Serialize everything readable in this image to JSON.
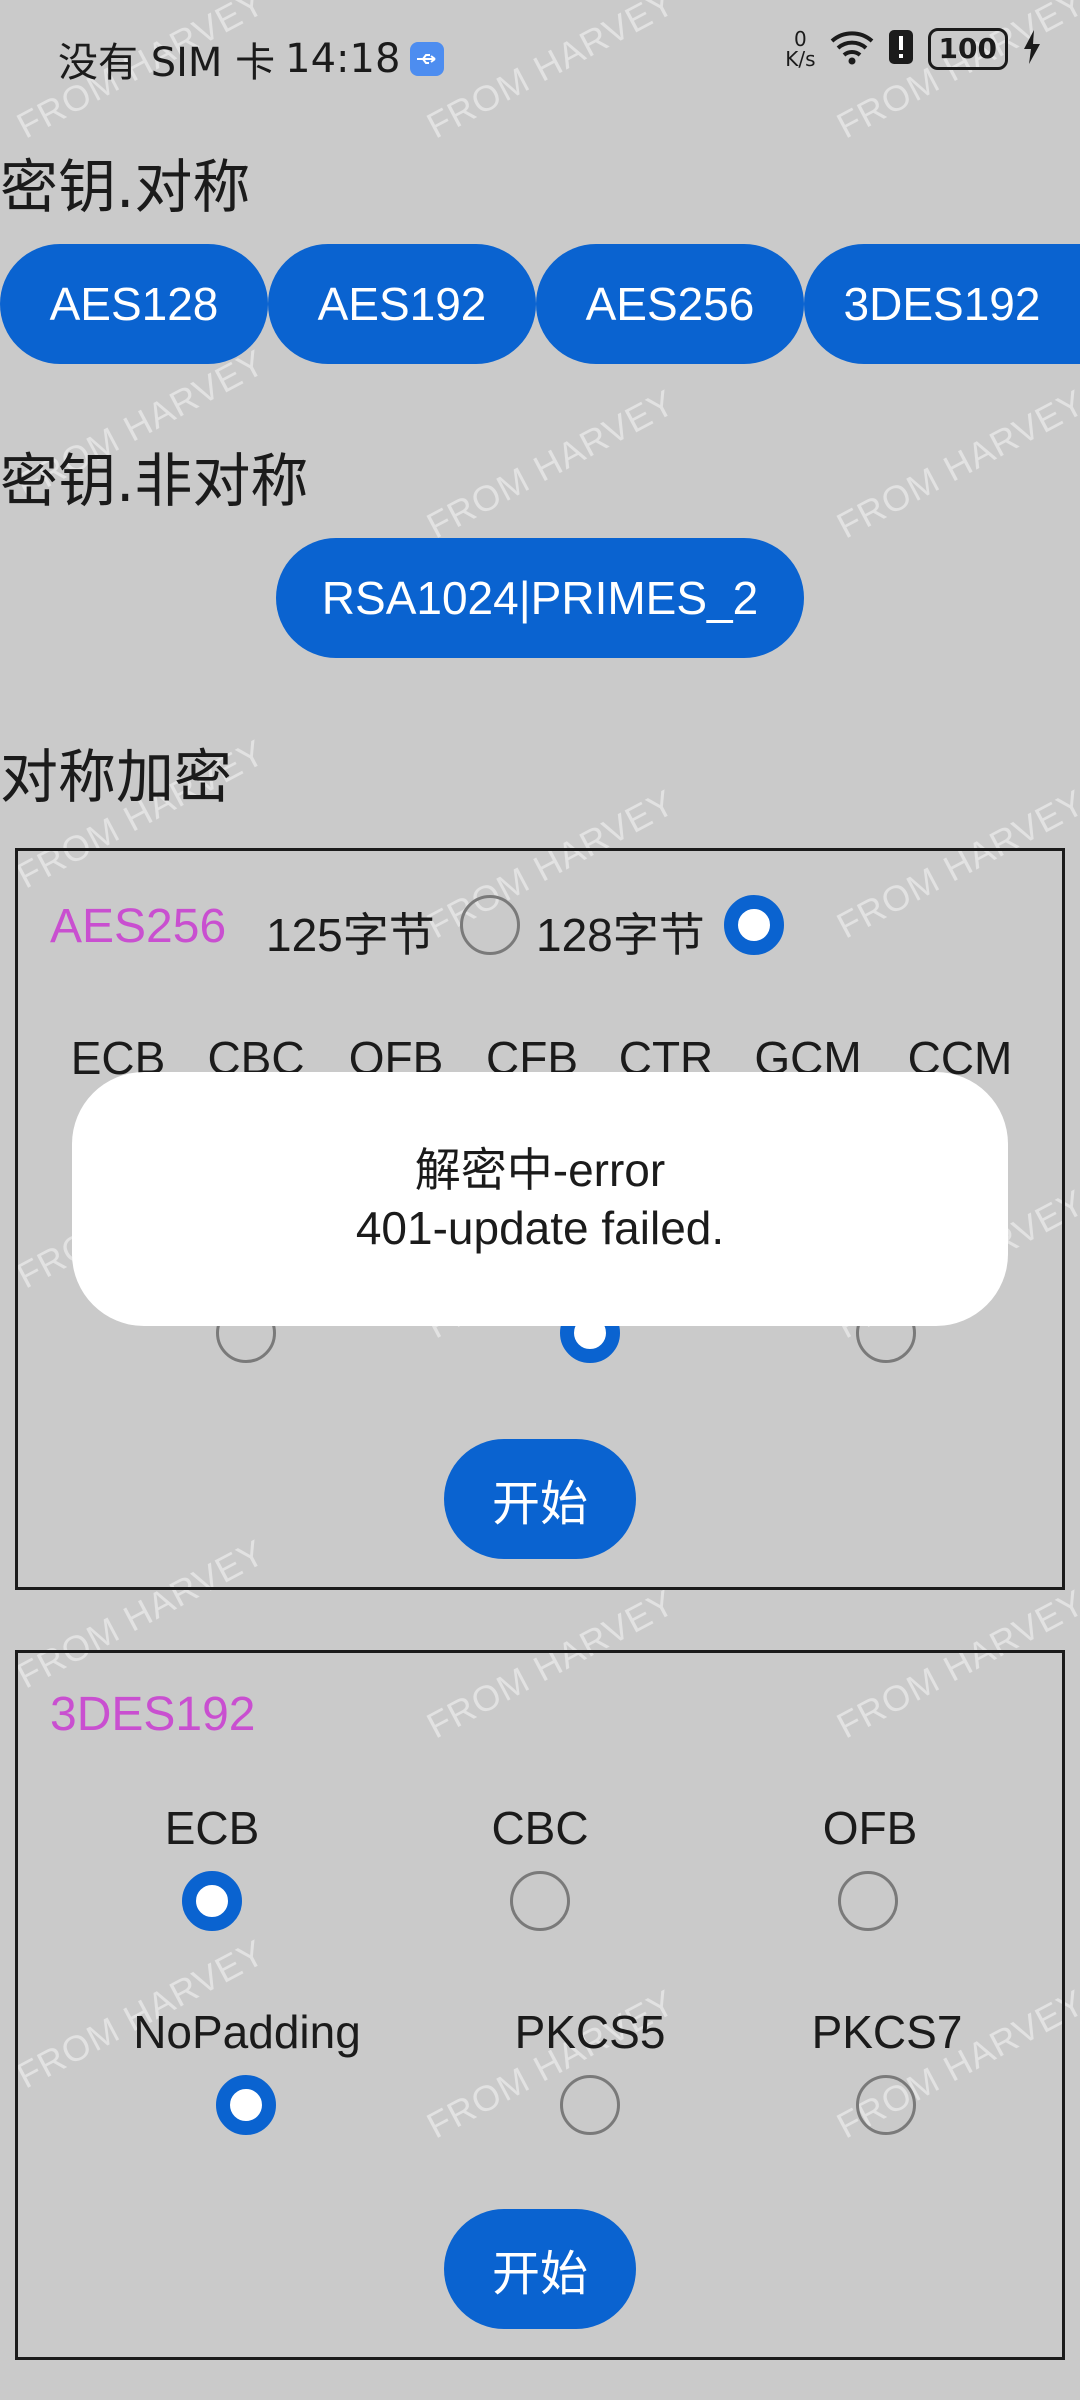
{
  "status_bar": {
    "carrier": "没有 SIM 卡",
    "time": "14:18",
    "net_speed_value": "0",
    "net_speed_unit": "K/s",
    "battery": "100"
  },
  "symmetric_keys": {
    "title": "密钥.对称",
    "buttons": [
      "AES128",
      "AES192",
      "AES256",
      "3DES192"
    ]
  },
  "asymmetric_keys": {
    "title": "密钥.非对称",
    "buttons": [
      "RSA1024|PRIMES_2"
    ]
  },
  "symmetric_encryption": {
    "title": "对称加密",
    "aes_card": {
      "title": "AES256",
      "size_options": [
        {
          "label": "125字节",
          "checked": false
        },
        {
          "label": "128字节",
          "checked": true
        }
      ],
      "modes": [
        "ECB",
        "CBC",
        "OFB",
        "CFB",
        "CTR",
        "GCM",
        "CCM"
      ],
      "padding_radios": [
        false,
        true,
        false
      ],
      "start_label": "开始"
    },
    "des_card": {
      "title": "3DES192",
      "modes": [
        {
          "label": "ECB",
          "checked": true
        },
        {
          "label": "CBC",
          "checked": false
        },
        {
          "label": "OFB",
          "checked": false
        }
      ],
      "paddings": [
        {
          "label": "NoPadding",
          "checked": true
        },
        {
          "label": "PKCS5",
          "checked": false
        },
        {
          "label": "PKCS7",
          "checked": false
        }
      ],
      "start_label": "开始"
    }
  },
  "toast": {
    "line1": "解密中-error",
    "line2": "401-update failed."
  },
  "watermark": "FROM HARVEY",
  "colors": {
    "accent": "#0a63d0",
    "card_title": "#c94fd0",
    "background": "#cacaca"
  }
}
